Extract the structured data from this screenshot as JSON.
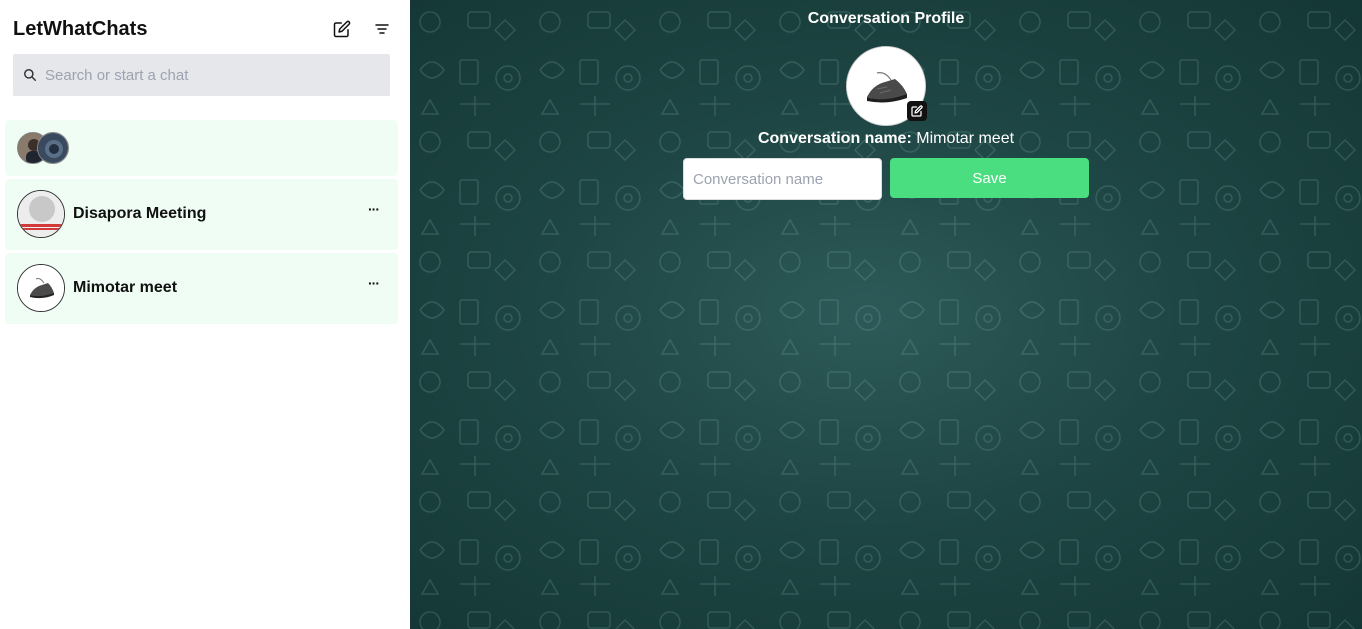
{
  "app": {
    "title": "LetWhatChats"
  },
  "search": {
    "placeholder": "Search or start a chat"
  },
  "chats": [
    {
      "name": ""
    },
    {
      "name": "Disapora Meeting",
      "more": "···"
    },
    {
      "name": "Mimotar meet",
      "more": "···"
    }
  ],
  "profile": {
    "title": "Conversation Profile",
    "name_label": "Conversation name:",
    "name_value": "Mimotar meet",
    "input_placeholder": "Conversation name",
    "save_label": "Save"
  },
  "colors": {
    "chat_item_bg": "#effdf4",
    "save_button": "#4ade80",
    "main_bg": "#1e4644"
  },
  "icons": {
    "new_chat": "edit-icon",
    "filter": "filter-icon",
    "search": "search-icon",
    "edit_avatar": "edit-icon"
  }
}
